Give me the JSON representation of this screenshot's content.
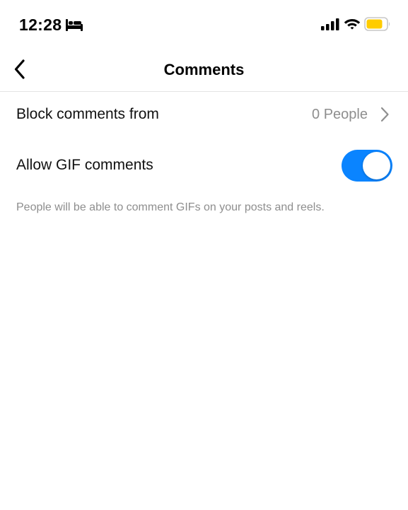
{
  "status_bar": {
    "time": "12:28",
    "sleep_mode_icon": "bed-icon",
    "battery_color": "#ffcc00"
  },
  "header": {
    "title": "Comments",
    "back_icon": "chevron-left-icon"
  },
  "settings": {
    "block_comments": {
      "label": "Block comments from",
      "value": "0 People"
    },
    "allow_gif": {
      "label": "Allow GIF comments",
      "enabled": true,
      "toggle_color": "#0a84ff",
      "helper": "People will be able to comment GIFs on your posts and reels."
    }
  }
}
